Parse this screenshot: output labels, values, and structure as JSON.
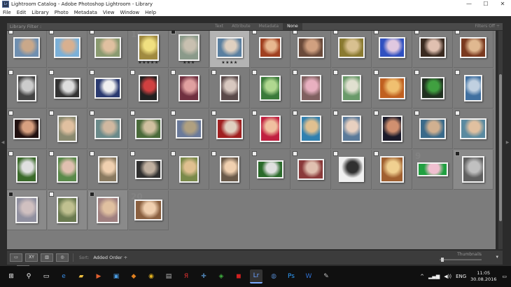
{
  "window": {
    "title": "Lightroom Catalog - Adobe Photoshop Lightroom - Library",
    "app_icon": "Lr",
    "controls": [
      "—",
      "☐",
      "✕"
    ]
  },
  "menu": [
    {
      "label": "File"
    },
    {
      "label": "Edit"
    },
    {
      "label": "Library"
    },
    {
      "label": "Photo"
    },
    {
      "label": "Metadata"
    },
    {
      "label": "View"
    },
    {
      "label": "Window"
    },
    {
      "label": "Help"
    }
  ],
  "filter_bar": {
    "label": "Library Filter :",
    "tabs": [
      {
        "label": "Text",
        "active": false
      },
      {
        "label": "Attribute",
        "active": false
      },
      {
        "label": "Metadata",
        "active": false
      },
      {
        "label": "None",
        "active": true
      }
    ],
    "filters_off": "Filters Off ÷"
  },
  "grid": {
    "rows": [
      [
        {
          "n": "",
          "badge": "white",
          "c1": "#6f8fb0",
          "c2": "#c9a88a",
          "w": 34,
          "h": 26,
          "stars": ""
        },
        {
          "n": "",
          "badge": "white",
          "c1": "#7bb0d8",
          "c2": "#d8b090",
          "w": 34,
          "h": 26,
          "stars": ""
        },
        {
          "n": "",
          "badge": "white",
          "c1": "#8a9a70",
          "c2": "#e0c0a0",
          "w": 34,
          "h": 26,
          "stars": ""
        },
        {
          "n": "16",
          "badge": "",
          "c1": "#a08a40",
          "c2": "#f0e080",
          "w": 26,
          "h": 34,
          "stars": "★★★★★"
        },
        {
          "n": "",
          "badge": "dark",
          "c1": "#8a9a8a",
          "c2": "#c8c0b0",
          "w": 26,
          "h": 34,
          "stars": "★★★"
        },
        {
          "n": "",
          "badge": "",
          "c1": "#5a7fa0",
          "c2": "#e0d0c0",
          "w": 34,
          "h": 26,
          "stars": "★★★★",
          "sel": true
        },
        {
          "n": "",
          "badge": "white",
          "c1": "#a04020",
          "c2": "#e8b890",
          "w": 28,
          "h": 26,
          "stars": ""
        },
        {
          "n": "",
          "badge": "white",
          "c1": "#6a4a3a",
          "c2": "#d0a080",
          "w": 34,
          "h": 26,
          "stars": ""
        },
        {
          "n": "",
          "badge": "white",
          "c1": "#8a7a30",
          "c2": "#d8c090",
          "w": 34,
          "h": 26,
          "stars": ""
        },
        {
          "n": "2",
          "badge": "white",
          "c1": "#3050c0",
          "c2": "#e0c8e0",
          "w": 34,
          "h": 26,
          "stars": ""
        },
        {
          "n": "3",
          "badge": "white",
          "c1": "#3a2a20",
          "c2": "#e0c0b0",
          "w": 34,
          "h": 26,
          "stars": ""
        },
        {
          "n": "",
          "badge": "white",
          "c1": "#7a3a20",
          "c2": "#e0b890",
          "w": 34,
          "h": 26,
          "stars": ""
        }
      ],
      [
        {
          "n": "",
          "badge": "white",
          "c1": "#444",
          "c2": "#ccc",
          "w": 24,
          "h": 34,
          "stars": ""
        },
        {
          "n": "",
          "badge": "white",
          "c1": "#333",
          "c2": "#ddd",
          "w": 34,
          "h": 26,
          "stars": ""
        },
        {
          "n": "",
          "badge": "white",
          "c1": "#2a3a70",
          "c2": "#f0f0f0",
          "w": 34,
          "h": 26,
          "stars": ""
        },
        {
          "n": "",
          "badge": "white",
          "c1": "#202020",
          "c2": "#d04040",
          "w": 24,
          "h": 34,
          "stars": ""
        },
        {
          "n": "",
          "badge": "white",
          "c1": "#703040",
          "c2": "#e0a0a0",
          "w": 26,
          "h": 34,
          "stars": ""
        },
        {
          "n": "",
          "badge": "white",
          "c1": "#5a4a4a",
          "c2": "#d8c8c0",
          "w": 24,
          "h": 34,
          "stars": ""
        },
        {
          "n": "",
          "badge": "white",
          "c1": "#3a7a3a",
          "c2": "#b0d890",
          "w": 26,
          "h": 32,
          "stars": ""
        },
        {
          "n": "",
          "badge": "white",
          "c1": "#806060",
          "c2": "#e8b0c0",
          "w": 26,
          "h": 34,
          "stars": ""
        },
        {
          "n": "",
          "badge": "white",
          "c1": "#6a9a6a",
          "c2": "#e0e0d0",
          "w": 24,
          "h": 34,
          "stars": ""
        },
        {
          "n": "",
          "badge": "white",
          "c1": "#c06020",
          "c2": "#f0c070",
          "w": 34,
          "h": 28,
          "stars": ""
        },
        {
          "n": "",
          "badge": "white",
          "c1": "#203020",
          "c2": "#40a040",
          "w": 30,
          "h": 28,
          "stars": ""
        },
        {
          "n": "",
          "badge": "white",
          "c1": "#4070a0",
          "c2": "#c0d0e0",
          "w": 22,
          "h": 34,
          "stars": ""
        }
      ],
      [
        {
          "n": "",
          "badge": "white",
          "c1": "#201010",
          "c2": "#d8a080",
          "w": 34,
          "h": 26,
          "stars": ""
        },
        {
          "n": "",
          "badge": "white",
          "c1": "#8a8a70",
          "c2": "#e0c0a0",
          "w": 24,
          "h": 34,
          "stars": ""
        },
        {
          "n": "",
          "badge": "white",
          "c1": "#6a8a8a",
          "c2": "#d0b8a0",
          "w": 34,
          "h": 26,
          "stars": ""
        },
        {
          "n": "",
          "badge": "white",
          "c1": "#4a6a3a",
          "c2": "#d0c0a0",
          "w": 34,
          "h": 26,
          "stars": ""
        },
        {
          "n": "",
          "badge": "white",
          "c1": "#6a7a9a",
          "c2": "#b0a080",
          "w": 34,
          "h": 24,
          "stars": ""
        },
        {
          "n": "",
          "badge": "white",
          "c1": "#a02020",
          "c2": "#e0d0c0",
          "w": 34,
          "h": 26,
          "stars": ""
        },
        {
          "n": "",
          "badge": "white",
          "c1": "#c02040",
          "c2": "#f0c0a0",
          "w": 26,
          "h": 34,
          "stars": ""
        },
        {
          "n": "",
          "badge": "white",
          "c1": "#3080b0",
          "c2": "#e0c090",
          "w": 26,
          "h": 34,
          "stars": ""
        },
        {
          "n": "",
          "badge": "white",
          "c1": "#5a7a9a",
          "c2": "#e8d0c0",
          "w": 24,
          "h": 34,
          "stars": ""
        },
        {
          "n": "",
          "badge": "white",
          "c1": "#1a1a2a",
          "c2": "#d09070",
          "w": 26,
          "h": 34,
          "stars": ""
        },
        {
          "n": "",
          "badge": "white",
          "c1": "#3a6a8a",
          "c2": "#d0b090",
          "w": 34,
          "h": 26,
          "stars": ""
        },
        {
          "n": "",
          "badge": "white",
          "c1": "#5a8aa0",
          "c2": "#e0c0a0",
          "w": 34,
          "h": 26,
          "stars": ""
        }
      ],
      [
        {
          "n": "",
          "badge": "white",
          "c1": "#3a6a2a",
          "c2": "#e0e0e0",
          "w": 26,
          "h": 34,
          "stars": ""
        },
        {
          "n": "",
          "badge": "white",
          "c1": "#5a8a4a",
          "c2": "#e0c0b0",
          "w": 26,
          "h": 34,
          "stars": ""
        },
        {
          "n": "",
          "badge": "white",
          "c1": "#8a7a60",
          "c2": "#f0d0b0",
          "w": 24,
          "h": 34,
          "stars": ""
        },
        {
          "n": "",
          "badge": "white",
          "c1": "#303030",
          "c2": "#c0b0a0",
          "w": 34,
          "h": 24,
          "stars": ""
        },
        {
          "n": "",
          "badge": "white",
          "c1": "#7a8a4a",
          "c2": "#e0c090",
          "w": 24,
          "h": 34,
          "stars": ""
        },
        {
          "n": "",
          "badge": "white",
          "c1": "#6a5a4a",
          "c2": "#f0d0b0",
          "w": 24,
          "h": 34,
          "stars": ""
        },
        {
          "n": "",
          "badge": "white",
          "c1": "#2a6a2a",
          "c2": "#e0e0e0",
          "w": 34,
          "h": 22,
          "stars": ""
        },
        {
          "n": "",
          "badge": "white",
          "c1": "#8a3a3a",
          "c2": "#e0c0b0",
          "w": 34,
          "h": 26,
          "stars": ""
        },
        {
          "n": "",
          "badge": "white",
          "c1": "#f0f0f0",
          "c2": "#303030",
          "w": 32,
          "h": 32,
          "stars": ""
        },
        {
          "n": "",
          "badge": "white",
          "c1": "#a06030",
          "c2": "#f0d090",
          "w": 30,
          "h": 34,
          "stars": ""
        },
        {
          "n": "9",
          "badge": "",
          "c1": "#20a040",
          "c2": "#f0c0d0",
          "w": 40,
          "h": 16,
          "stars": ""
        },
        {
          "n": "",
          "badge": "dark",
          "c1": "#606060",
          "c2": "#c0c0c0",
          "w": 28,
          "h": 34,
          "stars": "",
          "dim": true
        }
      ],
      [
        {
          "n": "",
          "badge": "dark",
          "c1": "#9090a0",
          "c2": "#d0c0c0",
          "w": 28,
          "h": 34,
          "stars": "",
          "dim": true
        },
        {
          "n": "",
          "badge": "white",
          "c1": "#6a7a50",
          "c2": "#c0c090",
          "w": 26,
          "h": 34,
          "stars": "",
          "dim": true
        },
        {
          "n": "",
          "badge": "dark",
          "c1": "#a08080",
          "c2": "#e0c0a0",
          "w": 28,
          "h": 34,
          "stars": "",
          "dim": true
        },
        {
          "n": "20",
          "badge": "",
          "c1": "#8a6040",
          "c2": "#f0d0b0",
          "w": 36,
          "h": 26,
          "stars": ""
        }
      ]
    ]
  },
  "toolbar": {
    "views": [
      "▦",
      "▭",
      "XY",
      "▥",
      "◎"
    ],
    "sort_label": "Sort:",
    "sort_value": "Added Order ÷",
    "thumbnails_label": "Thumbnails",
    "down": "▾"
  },
  "taskbar": {
    "icons": [
      {
        "name": "windows-start-icon",
        "glyph": "⊞",
        "color": "#ffffff"
      },
      {
        "name": "search-icon",
        "glyph": "⚲",
        "color": "#ffffff"
      },
      {
        "name": "task-view-icon",
        "glyph": "▭",
        "color": "#ffffff"
      },
      {
        "name": "edge-icon",
        "glyph": "e",
        "color": "#3a8ee6"
      },
      {
        "name": "file-explorer-icon",
        "glyph": "▰",
        "color": "#f0c040"
      },
      {
        "name": "media-icon",
        "glyph": "▶",
        "color": "#e06030"
      },
      {
        "name": "photos-icon",
        "glyph": "▣",
        "color": "#4a9ae0"
      },
      {
        "name": "app-icon",
        "glyph": "◆",
        "color": "#e08020"
      },
      {
        "name": "chrome-icon",
        "glyph": "◉",
        "color": "#e0b020"
      },
      {
        "name": "store-icon",
        "glyph": "▤",
        "color": "#b0b0b0"
      },
      {
        "name": "yandex-icon",
        "glyph": "Я",
        "color": "#e03030"
      },
      {
        "name": "vk-icon",
        "glyph": "✚",
        "color": "#4a7aa8"
      },
      {
        "name": "green-app-icon",
        "glyph": "◈",
        "color": "#40b040"
      },
      {
        "name": "red-app-icon",
        "glyph": "◼",
        "color": "#d02020"
      },
      {
        "name": "lightroom-icon",
        "glyph": "Lr",
        "color": "#6aa0ff",
        "active": true
      },
      {
        "name": "circle-app-icon",
        "glyph": "◍",
        "color": "#5080c0"
      },
      {
        "name": "photoshop-icon",
        "glyph": "Ps",
        "color": "#30a0ff"
      },
      {
        "name": "word-icon",
        "glyph": "W",
        "color": "#3070d0"
      },
      {
        "name": "paint-icon",
        "glyph": "✎",
        "color": "#c0c0c0"
      }
    ],
    "tray": {
      "up_arrow": "^",
      "network": "▂▄▆",
      "volume": "◀))",
      "lang": "ENG",
      "time": "11:05",
      "date": "30.08.2016",
      "notif": "▭"
    }
  }
}
